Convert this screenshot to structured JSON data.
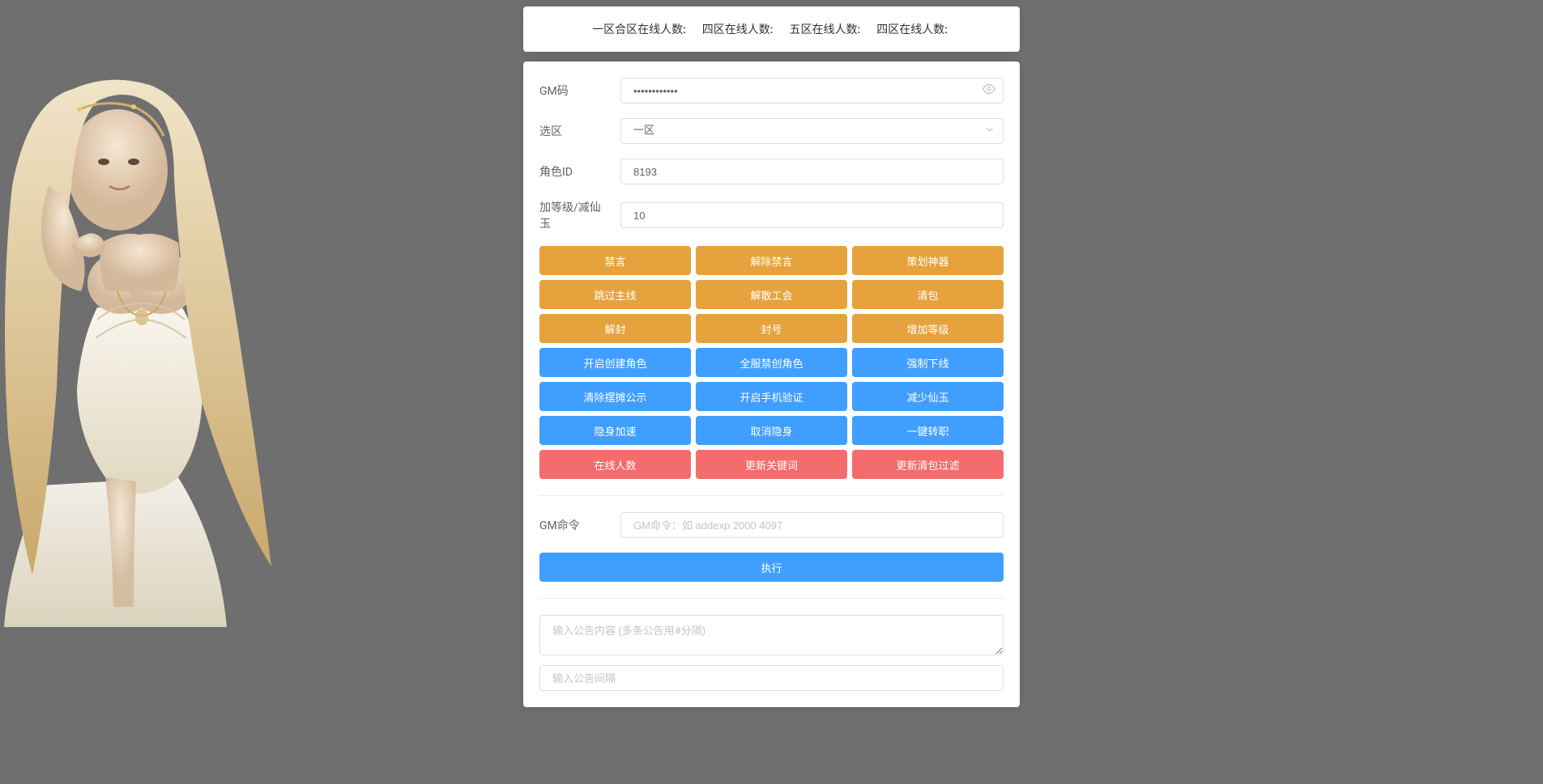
{
  "header": {
    "items": [
      {
        "label": "一区合区在线人数:",
        "value": ""
      },
      {
        "label": "四区在线人数:",
        "value": ""
      },
      {
        "label": "五区在线人数:",
        "value": ""
      },
      {
        "label": "四区在线人数:",
        "value": ""
      }
    ]
  },
  "form": {
    "gm_code": {
      "label": "GM码",
      "value": "••••••••••••"
    },
    "zone": {
      "label": "选区",
      "value": "一区"
    },
    "role_id": {
      "label": "角色ID",
      "value": "8193"
    },
    "level_jade": {
      "label": "加等级/减仙玉",
      "value": "10"
    }
  },
  "buttons": {
    "warning_rows": [
      [
        "禁言",
        "解除禁言",
        "策划神器"
      ],
      [
        "跳过主线",
        "解散工会",
        "清包"
      ],
      [
        "解封",
        "封号",
        "增加等级"
      ]
    ],
    "primary_rows": [
      [
        "开启创建角色",
        "全服禁创角色",
        "强制下线"
      ],
      [
        "清除摆摊公示",
        "开启手机验证",
        "减少仙玉"
      ],
      [
        "隐身加速",
        "取消隐身",
        "一键转职"
      ]
    ],
    "danger_rows": [
      [
        "在线人数",
        "更新关键词",
        "更新清包过滤"
      ]
    ]
  },
  "gm_cmd": {
    "label": "GM命令",
    "placeholder": "GM命令：如 addexp 2000 4097",
    "execute": "执行"
  },
  "announce": {
    "content_placeholder": "输入公告内容 (多条公告用#分隔)",
    "interval_placeholder": "输入公告间隔"
  }
}
